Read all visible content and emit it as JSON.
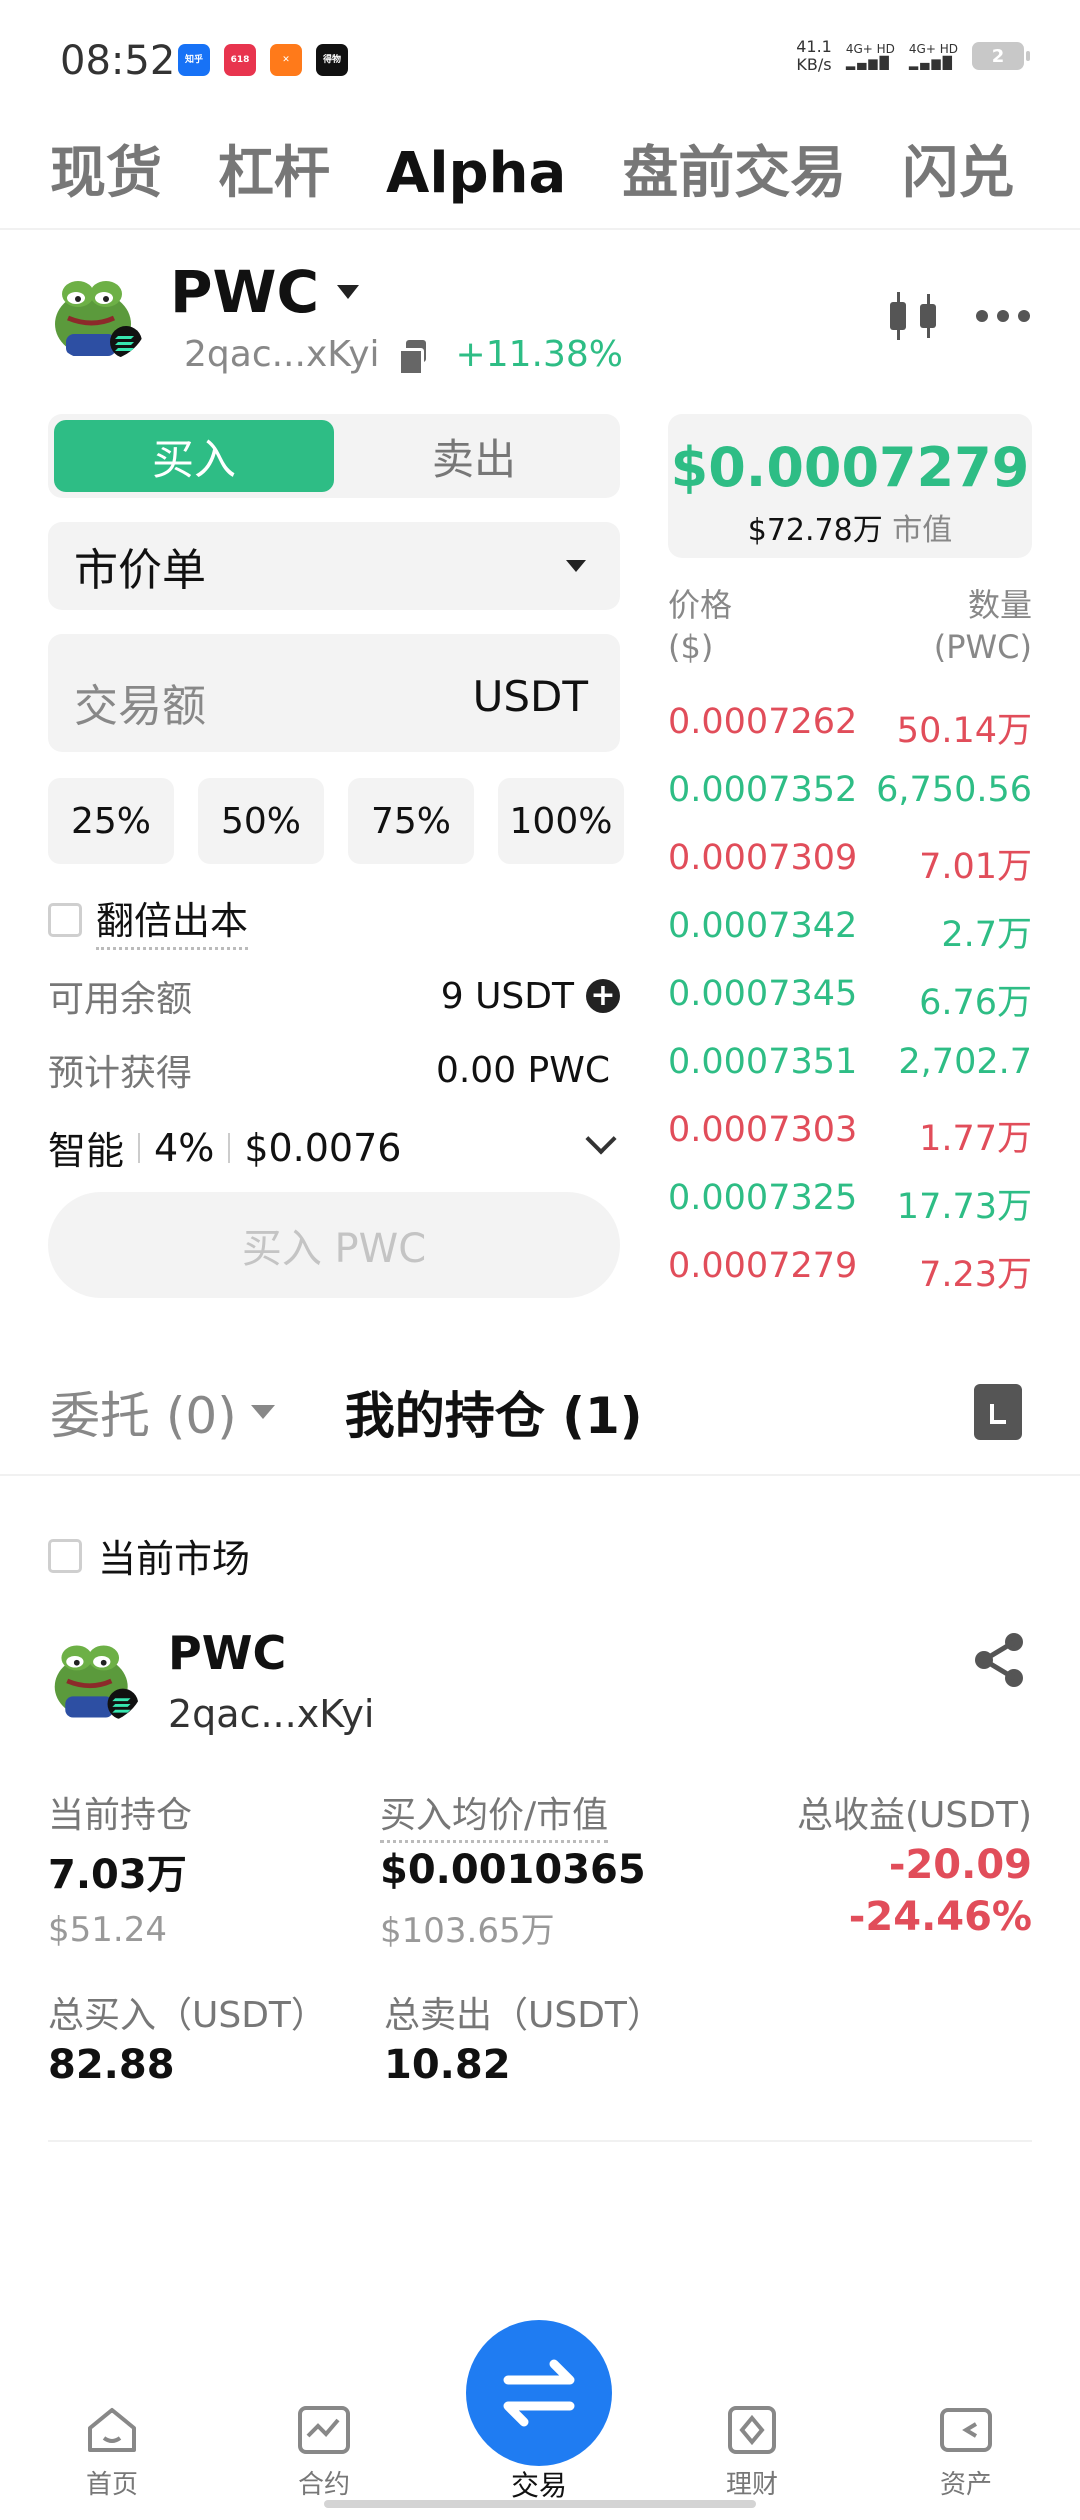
{
  "status_bar": {
    "time": "08:52",
    "apps": [
      {
        "label": "知乎",
        "color": "#1772f6"
      },
      {
        "label": "618",
        "color": "#e8344e"
      },
      {
        "label": "✕",
        "color": "#ff7a1a"
      },
      {
        "label": "得物",
        "color": "#111111"
      }
    ],
    "net_speed": "41.1",
    "net_unit": "KB/s",
    "sig1": "4G+ HD",
    "sig2": "4G+ HD",
    "battery": "2"
  },
  "top_tabs": [
    "现货",
    "杠杆",
    "Alpha",
    "盘前交易",
    "闪兑"
  ],
  "top_tab_active": "Alpha",
  "token": {
    "name": "PWC",
    "address": "2qac...xKyi",
    "change": "+11.38%"
  },
  "trade_form": {
    "buy_label": "买入",
    "sell_label": "卖出",
    "order_type": "市价单",
    "amount_placeholder": "交易额",
    "amount_unit": "USDT",
    "percent_buttons": [
      "25%",
      "50%",
      "75%",
      "100%"
    ],
    "double_label": "翻倍出本",
    "available_label": "可用余额",
    "available_value": "9 USDT",
    "expected_label": "预计获得",
    "expected_value": "0.00 PWC",
    "smart_label": "智能",
    "smart_pct": "4%",
    "smart_fee": "$0.0076",
    "submit_label": "买入 PWC"
  },
  "order_book": {
    "price": "$0.0007279",
    "market_cap_value": "$72.78万",
    "market_cap_label": "市值",
    "price_header": "价格",
    "price_unit": "($)",
    "qty_header": "数量",
    "qty_unit": "(PWC)",
    "rows": [
      {
        "price": "0.0007262",
        "qty": "50.14万",
        "side": "sell",
        "color": "#e14d5a"
      },
      {
        "price": "0.0007352",
        "qty": "6,750.56",
        "side": "buy",
        "color": "#2ebd85"
      },
      {
        "price": "0.0007309",
        "qty": "7.01万",
        "side": "sell",
        "color": "#e14d5a"
      },
      {
        "price": "0.0007342",
        "qty": "2.7万",
        "side": "buy",
        "color": "#2ebd85"
      },
      {
        "price": "0.0007345",
        "qty": "6.76万",
        "side": "buy",
        "color": "#2ebd85"
      },
      {
        "price": "0.0007351",
        "qty": "2,702.7",
        "side": "buy",
        "color": "#2ebd85"
      },
      {
        "price": "0.0007303",
        "qty": "1.77万",
        "side": "sell",
        "color": "#e14d5a"
      },
      {
        "price": "0.0007325",
        "qty": "17.73万",
        "side": "buy",
        "color": "#2ebd85"
      },
      {
        "price": "0.0007279",
        "qty": "7.23万",
        "side": "sell",
        "color": "#e14d5a"
      }
    ]
  },
  "positions": {
    "orders_tab": "委托 (0)",
    "holdings_tab": "我的持仓 (1)",
    "current_market_label": "当前市场",
    "holding": {
      "name": "PWC",
      "address": "2qac...xKyi",
      "current_label": "当前持仓",
      "current_value": "7.03万",
      "current_usd": "$51.24",
      "avg_label": "买入均价/市值",
      "avg_value": "$0.0010365",
      "avg_mc": "$103.65万",
      "pnl_label": "总收益(USDT)",
      "pnl_value": "-20.09",
      "pnl_pct": "-24.46%",
      "total_buy_label": "总买入（USDT）",
      "total_buy_value": "82.88",
      "total_sell_label": "总卖出（USDT）",
      "total_sell_value": "10.82"
    }
  },
  "bottom_nav": {
    "home": "首页",
    "futures": "合约",
    "trade": "交易",
    "earn": "理财",
    "assets": "资产"
  },
  "colors": {
    "up": "#2ebd85",
    "down": "#e14d5a",
    "accent": "#1f7cf2"
  }
}
